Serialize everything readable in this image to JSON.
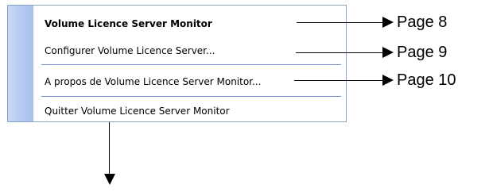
{
  "menu": {
    "items": [
      {
        "label": "Volume Licence Server Monitor"
      },
      {
        "label": "Configurer Volume Licence Server..."
      },
      {
        "label": "A propos de Volume Licence Server Monitor..."
      },
      {
        "label": "Quitter Volume Licence Server Monitor"
      }
    ]
  },
  "callouts": [
    {
      "label": "Page 8"
    },
    {
      "label": "Page 9"
    },
    {
      "label": "Page 10"
    }
  ],
  "colors": {
    "menu_border": "#8aa4c8",
    "gutter": "#b2caf0",
    "separator": "#6d8fcf"
  }
}
